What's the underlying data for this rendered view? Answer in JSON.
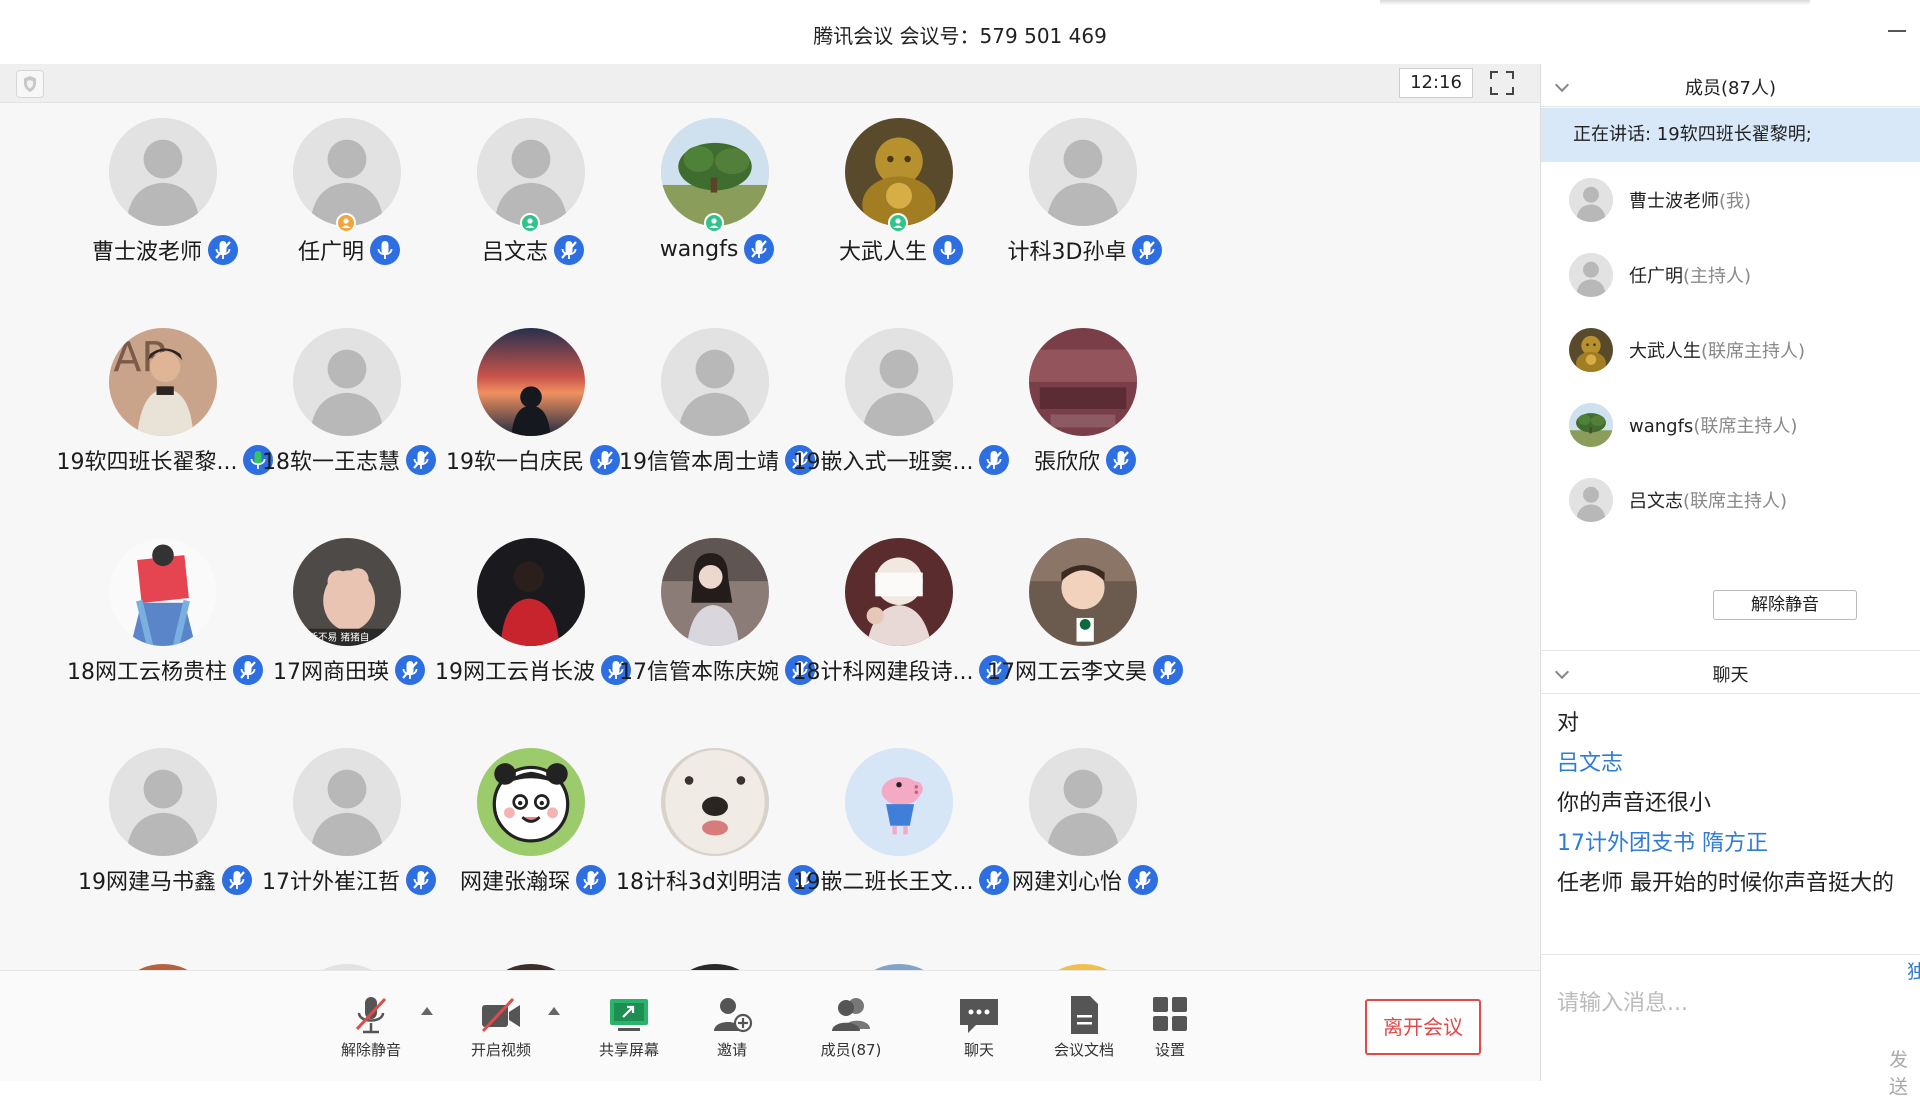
{
  "window": {
    "title": "腾讯会议 会议号：579 501 469"
  },
  "gallery": {
    "clock": "12:16",
    "participants": [
      {
        "name": "曹士波老师",
        "avatar": "default",
        "badge": "",
        "mic": "muted"
      },
      {
        "name": "任广明",
        "avatar": "default",
        "badge": "orange",
        "mic": "on"
      },
      {
        "name": "吕文志",
        "avatar": "default",
        "badge": "green",
        "mic": "muted"
      },
      {
        "name": "wangfs",
        "avatar": "tree",
        "badge": "green",
        "mic": "muted"
      },
      {
        "name": "大武人生",
        "avatar": "buddha",
        "badge": "green",
        "mic": "on"
      },
      {
        "name": "计科3D孙卓",
        "avatar": "default",
        "badge": "",
        "mic": "muted"
      },
      {
        "name": "19软四班长翟黎...",
        "avatar": "man",
        "badge": "",
        "mic": "speaking"
      },
      {
        "name": "18软一王志慧",
        "avatar": "default",
        "badge": "",
        "mic": "muted"
      },
      {
        "name": "19软一白庆民",
        "avatar": "sunset",
        "badge": "",
        "mic": "muted"
      },
      {
        "name": "19信管本周士靖",
        "avatar": "default",
        "badge": "",
        "mic": "muted"
      },
      {
        "name": "19嵌入式一班窦...",
        "avatar": "default",
        "badge": "",
        "mic": "muted"
      },
      {
        "name": "張欣欣",
        "avatar": "maroon",
        "badge": "",
        "mic": "muted"
      },
      {
        "name": "18网工云杨贵柱",
        "avatar": "reader",
        "badge": "",
        "mic": "muted"
      },
      {
        "name": "17网商田瑛",
        "avatar": "toy",
        "badge": "",
        "mic": "muted"
      },
      {
        "name": "19网工云肖长波",
        "avatar": "redshirt",
        "badge": "",
        "mic": "muted"
      },
      {
        "name": "17信管本陈庆婉",
        "avatar": "girl",
        "badge": "",
        "mic": "muted"
      },
      {
        "name": "18计科网建段诗...",
        "avatar": "masked",
        "badge": "",
        "mic": "muted"
      },
      {
        "name": "17网工云李文昊",
        "avatar": "child",
        "badge": "",
        "mic": "muted"
      },
      {
        "name": "19网建马书鑫",
        "avatar": "default",
        "badge": "",
        "mic": "muted"
      },
      {
        "name": "17计外崔江哲",
        "avatar": "default",
        "badge": "",
        "mic": "muted"
      },
      {
        "name": "网建张瀚琛",
        "avatar": "panda",
        "badge": "",
        "mic": "muted"
      },
      {
        "name": "18计科3d刘明洁",
        "avatar": "dog",
        "badge": "",
        "mic": "muted"
      },
      {
        "name": "19嵌二班长王文...",
        "avatar": "pig",
        "badge": "",
        "mic": "muted"
      },
      {
        "name": "网建刘心怡",
        "avatar": "default",
        "badge": "",
        "mic": "muted"
      }
    ]
  },
  "toolbar": {
    "unmute": "解除静音",
    "video": "开启视频",
    "share": "共享屏幕",
    "invite": "邀请",
    "members": "成员(87)",
    "chat": "聊天",
    "docs": "会议文档",
    "settings": "设置",
    "leave": "离开会议"
  },
  "members_panel": {
    "title": "成员(87人)",
    "speaking": "正在讲话: 19软四班长翟黎明;",
    "list": [
      {
        "name": "曹士波老师",
        "role": "(我)",
        "avatar": "default"
      },
      {
        "name": "任广明",
        "role": "(主持人)",
        "avatar": "default"
      },
      {
        "name": "大武人生",
        "role": "(联席主持人)",
        "avatar": "buddha"
      },
      {
        "name": "wangfs",
        "role": "(联席主持人)",
        "avatar": "tree"
      },
      {
        "name": "吕文志",
        "role": "(联席主持人)",
        "avatar": "default"
      }
    ],
    "unmute_all": "解除静音"
  },
  "chat_panel": {
    "title": "聊天",
    "messages": [
      {
        "type": "text",
        "text": "对"
      },
      {
        "type": "sender",
        "text": "吕文志"
      },
      {
        "type": "text",
        "text": "你的声音还很小"
      },
      {
        "type": "sender",
        "text": "17计外团支书 隋方正"
      },
      {
        "type": "text",
        "text": "任老师 最开始的时候你声音挺大的"
      }
    ],
    "corner_label": "独",
    "placeholder": "请输入消息...",
    "send": "发送"
  },
  "colors": {
    "accent": "#2f7bd6",
    "mic_blue": "#2d6fe0",
    "speaking_green": "#34c759",
    "leave_red": "#e24a4a",
    "speaking_bg": "#d8e8f9",
    "badge_green": "#2ec48a",
    "badge_orange": "#f2a53a"
  }
}
